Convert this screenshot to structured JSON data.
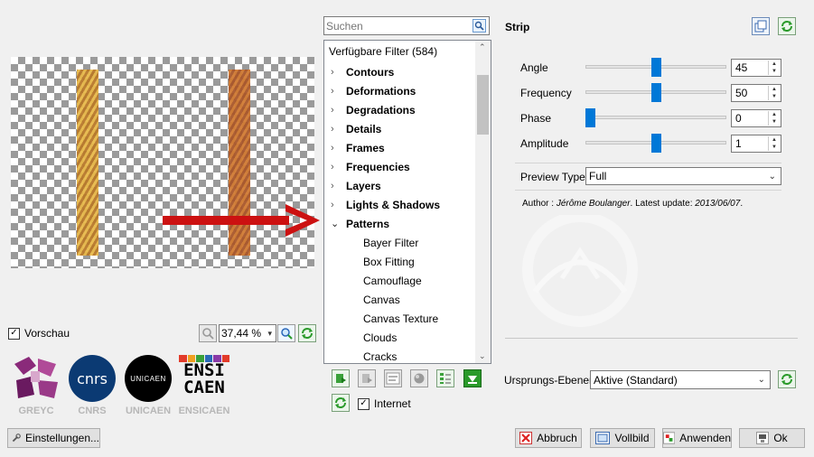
{
  "preview": {
    "checkbox_label": "Vorschau",
    "checked": true,
    "zoom_value": "37,44 %",
    "settings_label": "Einstellungen..."
  },
  "logos": [
    {
      "label": "GREYC"
    },
    {
      "label": "CNRS",
      "text": "cnrs"
    },
    {
      "label": "UNICAEN",
      "text": "UNICAEN"
    },
    {
      "label": "ENSICAEN",
      "text_line1": "ENSI",
      "text_line2": "CAEN"
    }
  ],
  "search": {
    "placeholder": "Suchen"
  },
  "filters": {
    "header": "Verfügbare Filter (584)",
    "categories": [
      {
        "label": "Contours",
        "expanded": false
      },
      {
        "label": "Deformations",
        "expanded": false
      },
      {
        "label": "Degradations",
        "expanded": false
      },
      {
        "label": "Details",
        "expanded": false
      },
      {
        "label": "Frames",
        "expanded": false
      },
      {
        "label": "Frequencies",
        "expanded": false
      },
      {
        "label": "Layers",
        "expanded": false
      },
      {
        "label": "Lights & Shadows",
        "expanded": false
      },
      {
        "label": "Patterns",
        "expanded": true
      }
    ],
    "pattern_items": [
      "Bayer Filter",
      "Box Fitting",
      "Camouflage",
      "Canvas",
      "Canvas Texture",
      "Clouds",
      "Cracks"
    ],
    "internet_label": "Internet",
    "internet_checked": true
  },
  "filter_settings": {
    "title": "Strip",
    "params": [
      {
        "label": "Angle",
        "value": "45",
        "fraction": 0.5
      },
      {
        "label": "Frequency",
        "value": "50",
        "fraction": 0.5
      },
      {
        "label": "Phase",
        "value": "0",
        "fraction": 0.0
      },
      {
        "label": "Amplitude",
        "value": "1",
        "fraction": 0.5
      }
    ],
    "preview_type_label": "Preview Type",
    "preview_type_value": "Full",
    "author_prefix": "Author : ",
    "author_name": "Jérôme Boulanger",
    "update_prefix": ". Latest update: ",
    "update_date": "2013/06/07",
    "update_suffix": "."
  },
  "layers": {
    "label": "Ursprungs-Ebenen",
    "value": "Aktive (Standard)"
  },
  "buttons": {
    "cancel": "Abbruch",
    "fullscreen": "Vollbild",
    "apply": "Anwenden",
    "ok": "Ok"
  },
  "colors": {
    "accent": "#0078d7",
    "arrow": "#cc1111",
    "stripe_left": "#d9a43a",
    "stripe_right": "#c9712a"
  }
}
